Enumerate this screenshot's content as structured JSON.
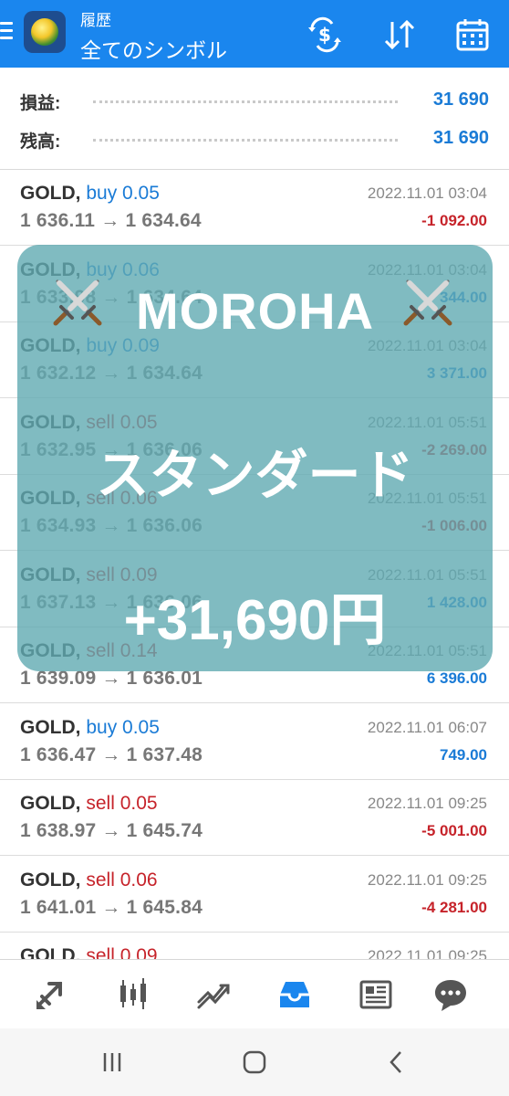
{
  "header": {
    "subtitle": "履歴",
    "title": "全てのシンボル",
    "icons": [
      "menu-icon",
      "app-logo",
      "currency-filter-icon",
      "sort-icon",
      "calendar-icon"
    ],
    "accent_color": "#1a86ee"
  },
  "summary": {
    "profit_label": "損益:",
    "profit_value": "31 690",
    "balance_label": "残高:",
    "balance_value": "31 690"
  },
  "deals": [
    {
      "symbol": "GOLD,",
      "type": "buy",
      "volume": "buy 0.05",
      "prices": "1 636.11 → 1 634.64",
      "time": "2022.11.01 03:04",
      "profit": "-1 092.00",
      "sign": "neg"
    },
    {
      "symbol": "GOLD,",
      "type": "buy",
      "volume": "buy 0.06",
      "prices": "1 633.98 → 1 634.64",
      "time": "2022.11.01 03:04",
      "profit": "344.00",
      "sign": "pos"
    },
    {
      "symbol": "GOLD,",
      "type": "buy",
      "volume": "buy 0.09",
      "prices": "1 632.12 → 1 634.64",
      "time": "2022.11.01 03:04",
      "profit": "3 371.00",
      "sign": "pos"
    },
    {
      "symbol": "GOLD,",
      "type": "sell",
      "volume": "sell 0.05",
      "prices": "1 632.95 → 1 636.06",
      "time": "2022.11.01 05:51",
      "profit": "-2 269.00",
      "sign": "neg"
    },
    {
      "symbol": "GOLD,",
      "type": "sell",
      "volume": "sell 0.06",
      "prices": "1 634.93 → 1 636.06",
      "time": "2022.11.01 05:51",
      "profit": "-1 006.00",
      "sign": "neg"
    },
    {
      "symbol": "GOLD,",
      "type": "sell",
      "volume": "sell 0.09",
      "prices": "1 637.13 → 1 636.06",
      "time": "2022.11.01 05:51",
      "profit": "1 428.00",
      "sign": "pos"
    },
    {
      "symbol": "GOLD,",
      "type": "sell",
      "volume": "sell 0.14",
      "prices": "1 639.09 → 1 636.01",
      "time": "2022.11.01 05:51",
      "profit": "6 396.00",
      "sign": "pos"
    },
    {
      "symbol": "GOLD,",
      "type": "buy",
      "volume": "buy 0.05",
      "prices": "1 636.47 → 1 637.48",
      "time": "2022.11.01 06:07",
      "profit": "749.00",
      "sign": "pos"
    },
    {
      "symbol": "GOLD,",
      "type": "sell",
      "volume": "sell 0.05",
      "prices": "1 638.97 → 1 645.74",
      "time": "2022.11.01 09:25",
      "profit": "-5 001.00",
      "sign": "neg"
    },
    {
      "symbol": "GOLD,",
      "type": "sell",
      "volume": "sell 0.06",
      "prices": "1 641.01 → 1 645.84",
      "time": "2022.11.01 09:25",
      "profit": "-4 281.00",
      "sign": "neg"
    },
    {
      "symbol": "GOLD,",
      "type": "sell",
      "volume": "sell 0.09",
      "prices": "",
      "time": "2022.11.01 09:25",
      "profit": "",
      "sign": "neg"
    }
  ],
  "overlay": {
    "title": "MOROHA",
    "subtitle": "スタンダード",
    "profit": "+31,690円",
    "icons": [
      "crossed-swords-icon",
      "crossed-swords-icon"
    ]
  },
  "bottom_nav": {
    "items": [
      "quotes-icon",
      "chart-icon",
      "trade-icon",
      "history-icon",
      "news-icon",
      "chat-icon"
    ],
    "active": "history-icon"
  },
  "system_nav": {
    "items": [
      "recent-apps-icon",
      "home-icon",
      "back-icon"
    ]
  },
  "colors": {
    "buy": "#1a7bd6",
    "sell": "#c6232a",
    "overlay": "#60aab1"
  }
}
